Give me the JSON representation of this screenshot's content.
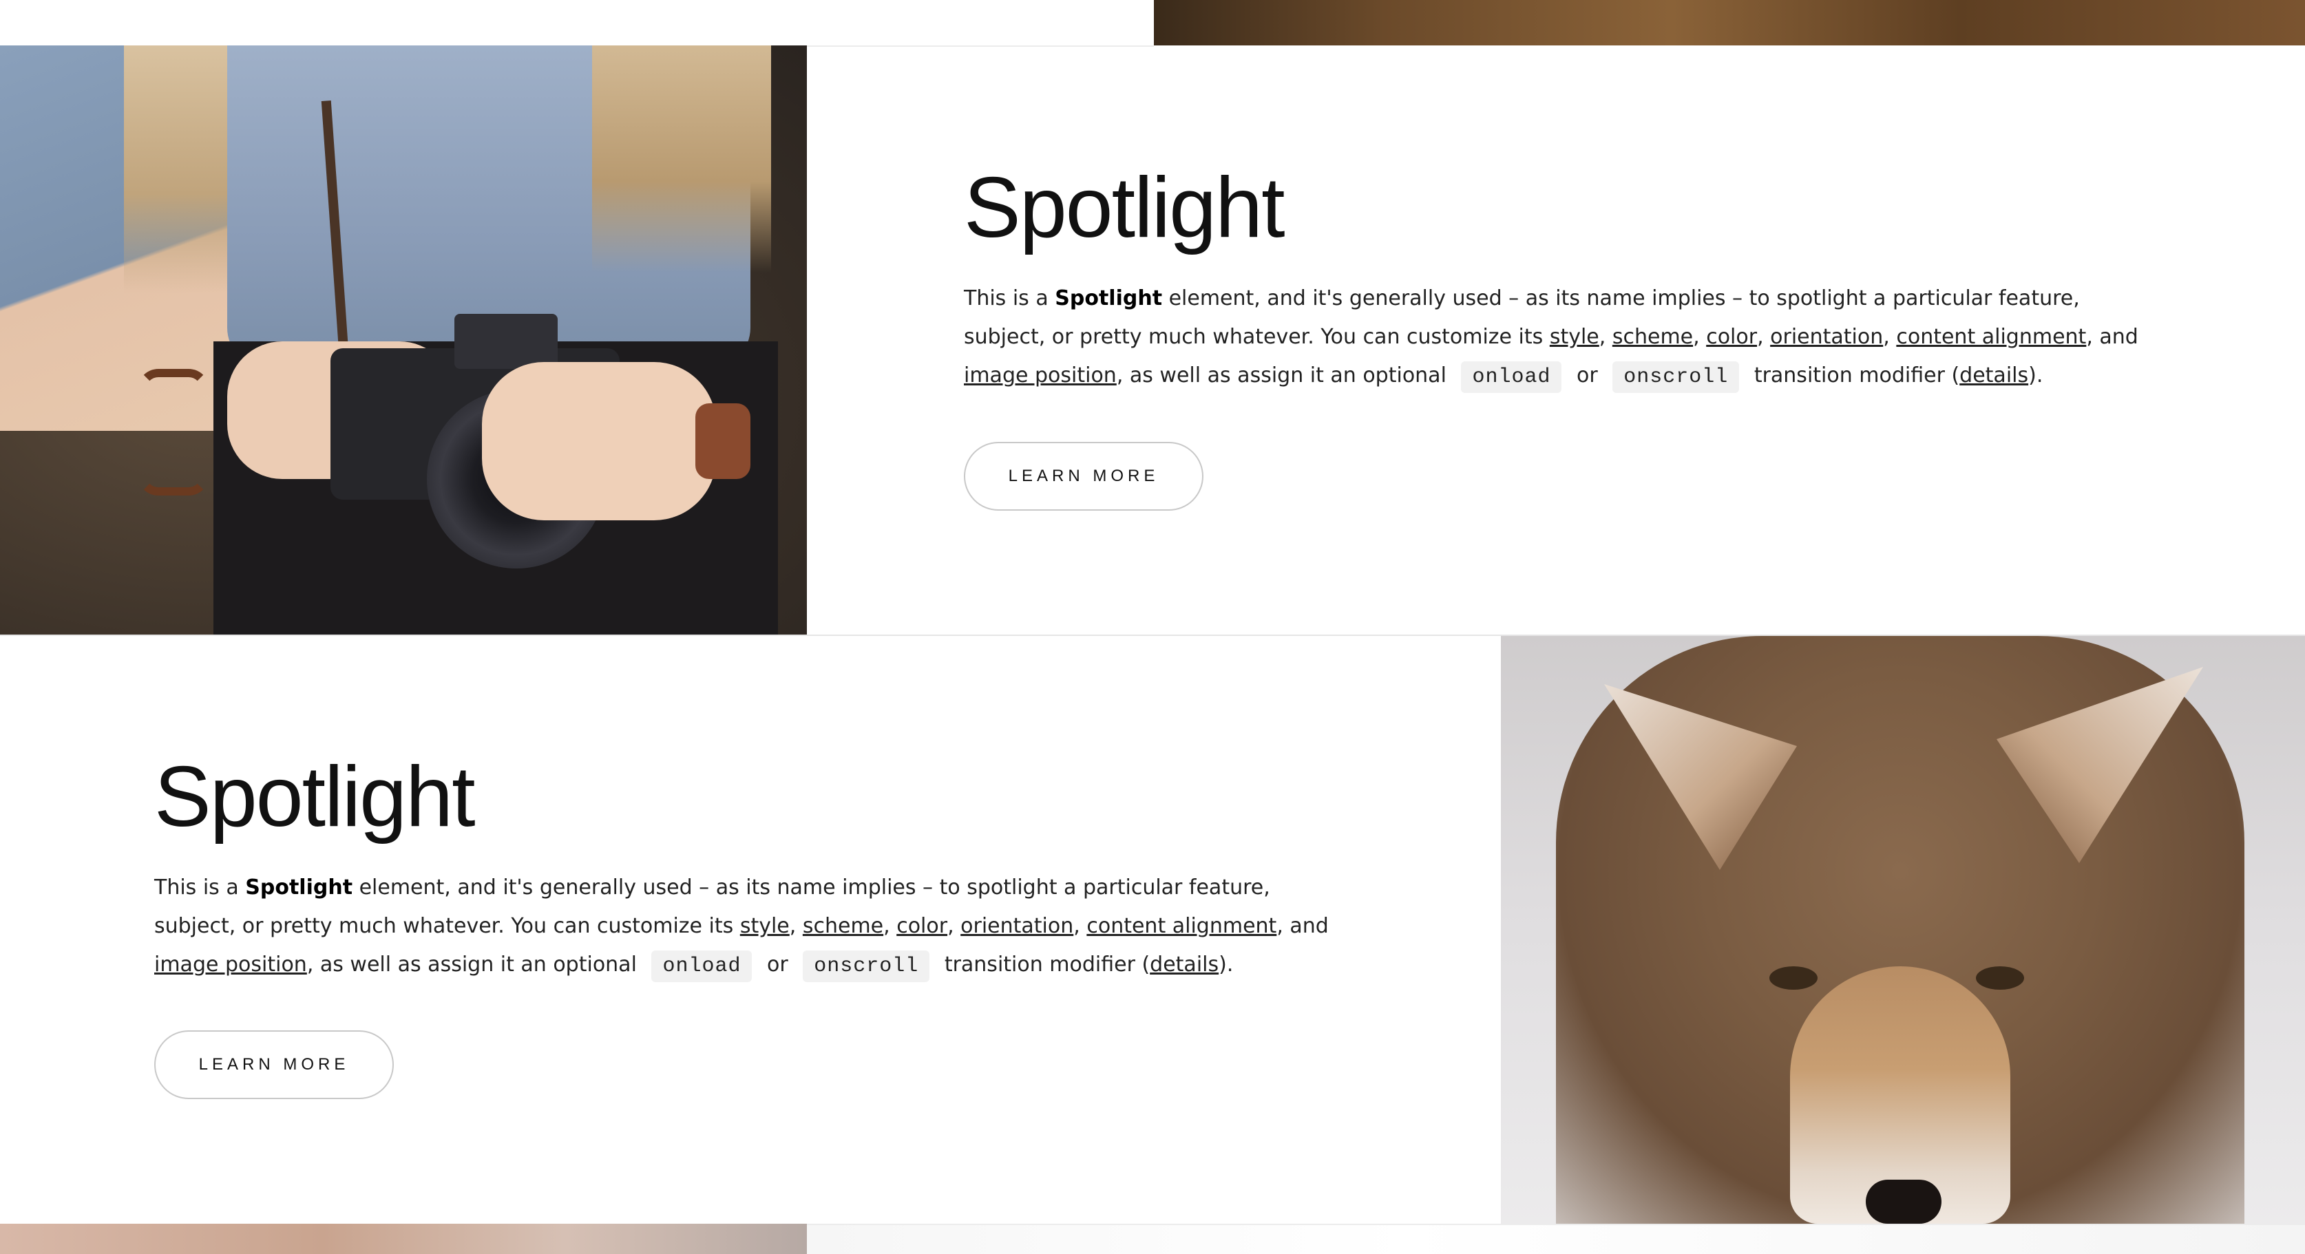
{
  "colors": {
    "background": "#ffffff",
    "text": "#222222",
    "button_border": "#c8c8c8",
    "code_bg": "#f1f1f1"
  },
  "spotlight_1": {
    "image": "woman-with-camera",
    "title": "Spotlight",
    "body": {
      "t1": "This is a ",
      "strong": "Spotlight",
      "t2": " element, and it's generally used – as its name implies – to spotlight a particular feature, subject, or pretty much whatever. You can customize its ",
      "link_style": "style",
      "sep1": ", ",
      "link_scheme": "scheme",
      "sep2": ", ",
      "link_color": "color",
      "sep3": ", ",
      "link_orientation": "orientation",
      "sep4": ", ",
      "link_content_alignment": "content alignment",
      "t3": ", and ",
      "link_image_position": "image position",
      "t4": ", as well as assign it an optional ",
      "code_onload": "onload",
      "t5": " or ",
      "code_onscroll": "onscroll",
      "t6": " transition modifier (",
      "link_details": "details",
      "t7": ")."
    },
    "button_label": "LEARN MORE"
  },
  "spotlight_2": {
    "image": "coyote",
    "title": "Spotlight",
    "body": {
      "t1": "This is a ",
      "strong": "Spotlight",
      "t2": " element, and it's generally used – as its name implies – to spotlight a particular feature, subject, or pretty much whatever. You can customize its ",
      "link_style": "style",
      "sep1": ", ",
      "link_scheme": "scheme",
      "sep2": ", ",
      "link_color": "color",
      "sep3": ", ",
      "link_orientation": "orientation",
      "sep4": ", ",
      "link_content_alignment": "content alignment",
      "t3": ", and ",
      "link_image_position": "image position",
      "t4": ", as well as assign it an optional ",
      "code_onload": "onload",
      "t5": " or ",
      "code_onscroll": "onscroll",
      "t6": " transition modifier (",
      "link_details": "details",
      "t7": ")."
    },
    "button_label": "LEARN MORE"
  }
}
